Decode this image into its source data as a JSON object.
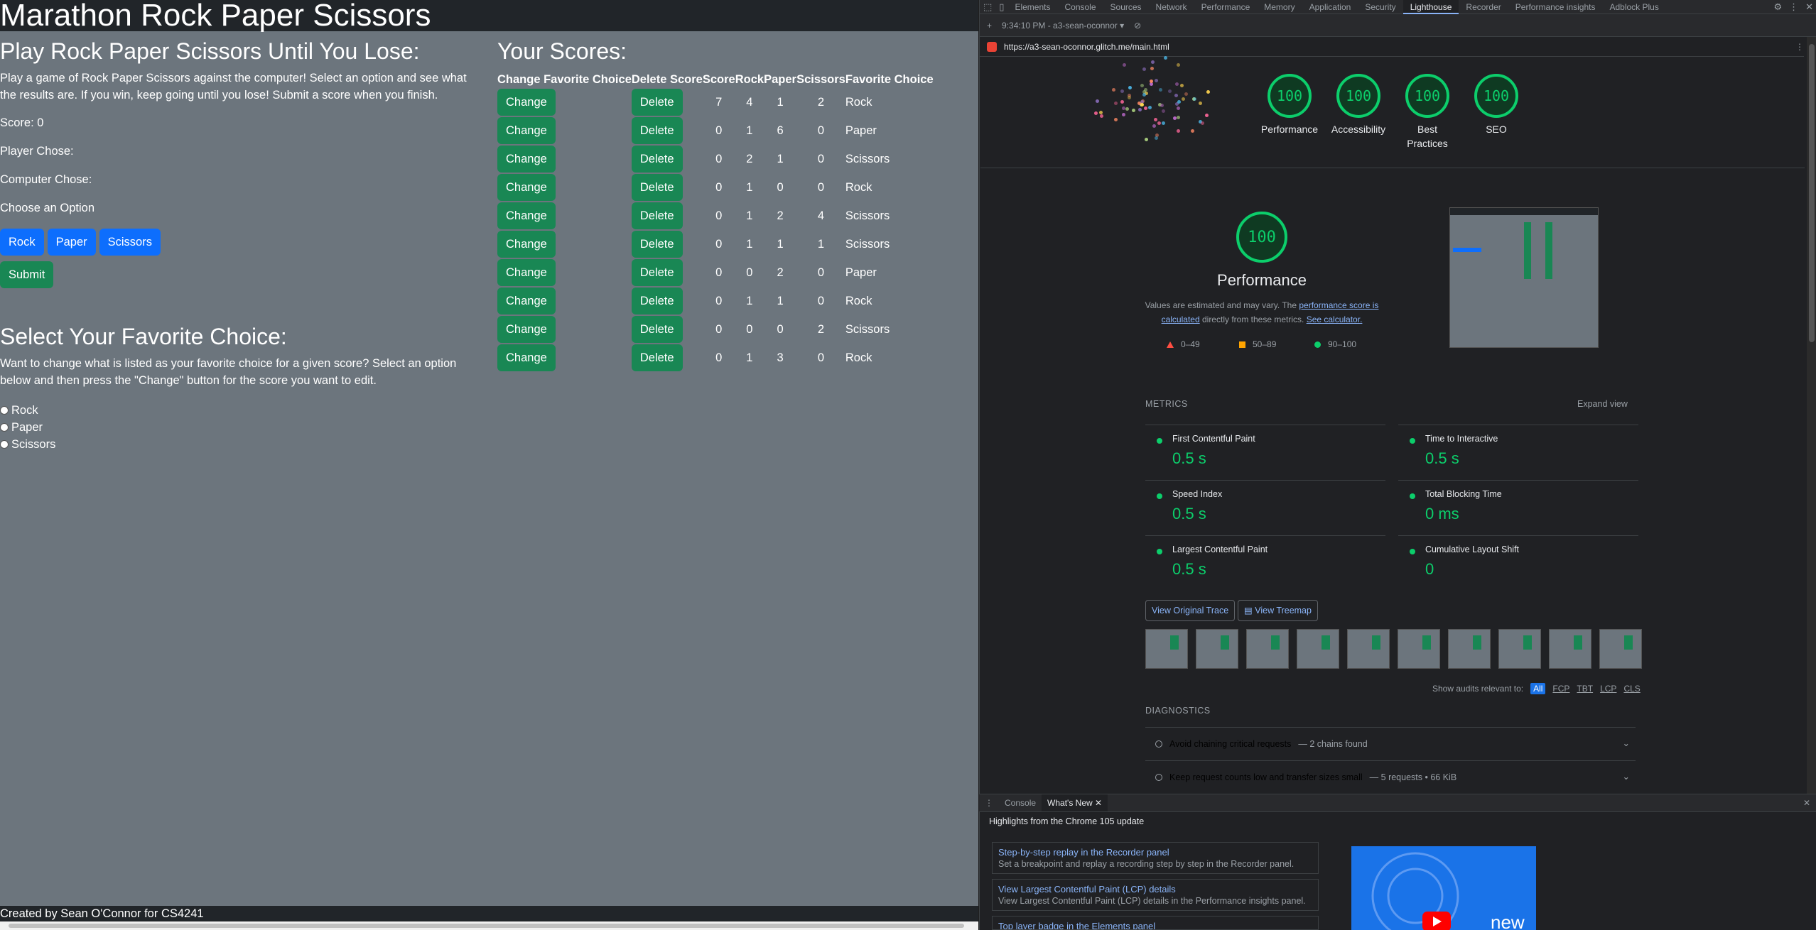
{
  "app": {
    "site_title": "Marathon Rock Paper Scissors",
    "play_heading": "Play Rock Paper Scissors Until You Lose:",
    "play_description": "Play a game of Rock Paper Scissors against the computer! Select an option and see what the results are. If you win, keep going until you lose! Submit a score when you finish.",
    "score_label": "Score: 0",
    "player_chose_label": "Player Chose:",
    "computer_chose_label": "Computer Chose:",
    "choose_option_label": "Choose an Option",
    "buttons": {
      "rock": "Rock",
      "paper": "Paper",
      "scissors": "Scissors",
      "submit": "Submit"
    },
    "favorite_heading": "Select Your Favorite Choice:",
    "favorite_description": "Want to change what is listed as your favorite choice for a given score? Select an option below and then press the \"Change\" button for the score you want to edit.",
    "radio_options": [
      "Rock",
      "Paper",
      "Scissors"
    ],
    "scores_heading": "Your Scores:",
    "table": {
      "headers": [
        "Change Favorite Choice",
        "Delete Score",
        "Score",
        "Rock",
        "Paper",
        "Scissors",
        "Favorite Choice"
      ],
      "change_label": "Change",
      "delete_label": "Delete",
      "rows": [
        {
          "score": "7",
          "rock": "4",
          "paper": "1",
          "scissors": "2",
          "favorite": "Rock"
        },
        {
          "score": "0",
          "rock": "1",
          "paper": "6",
          "scissors": "0",
          "favorite": "Paper"
        },
        {
          "score": "0",
          "rock": "2",
          "paper": "1",
          "scissors": "0",
          "favorite": "Scissors"
        },
        {
          "score": "0",
          "rock": "1",
          "paper": "0",
          "scissors": "0",
          "favorite": "Rock"
        },
        {
          "score": "0",
          "rock": "1",
          "paper": "2",
          "scissors": "4",
          "favorite": "Scissors"
        },
        {
          "score": "0",
          "rock": "1",
          "paper": "1",
          "scissors": "1",
          "favorite": "Scissors"
        },
        {
          "score": "0",
          "rock": "0",
          "paper": "2",
          "scissors": "0",
          "favorite": "Paper"
        },
        {
          "score": "0",
          "rock": "1",
          "paper": "1",
          "scissors": "0",
          "favorite": "Rock"
        },
        {
          "score": "0",
          "rock": "0",
          "paper": "0",
          "scissors": "2",
          "favorite": "Scissors"
        },
        {
          "score": "0",
          "rock": "1",
          "paper": "3",
          "scissors": "0",
          "favorite": "Rock"
        }
      ]
    },
    "footer": "Created by Sean O'Connor for CS4241",
    "colors": {
      "background": "#6c757d",
      "primary": "#0d6efd",
      "success": "#198754",
      "dark": "#212529"
    }
  },
  "devtools": {
    "tabs": [
      "Elements",
      "Console",
      "Sources",
      "Network",
      "Performance",
      "Memory",
      "Application",
      "Security",
      "Lighthouse",
      "Recorder",
      "Performance insights",
      "Adblock Plus"
    ],
    "active_tab": "Lighthouse",
    "report_selector": "9:34:10 PM - a3-sean-oconnor",
    "url": "https://a3-sean-oconnor.glitch.me/main.html",
    "gauges": [
      {
        "score": "100",
        "label": "Performance"
      },
      {
        "score": "100",
        "label": "Accessibility"
      },
      {
        "score": "100",
        "label": "Best Practices"
      },
      {
        "score": "100",
        "label": "SEO"
      }
    ],
    "main_score": "100",
    "perf_title": "Performance",
    "perf_note_1": "Values are estimated and may vary. The ",
    "perf_note_link1": "performance score is calculated",
    "perf_note_2": " directly from these metrics. ",
    "perf_note_link2": "See calculator.",
    "legend": [
      "0–49",
      "50–89",
      "90–100"
    ],
    "metrics_heading": "METRICS",
    "expand_view": "Expand view",
    "metrics": [
      {
        "name": "First Contentful Paint",
        "value": "0.5 s"
      },
      {
        "name": "Time to Interactive",
        "value": "0.5 s"
      },
      {
        "name": "Speed Index",
        "value": "0.5 s"
      },
      {
        "name": "Total Blocking Time",
        "value": "0 ms"
      },
      {
        "name": "Largest Contentful Paint",
        "value": "0.5 s"
      },
      {
        "name": "Cumulative Layout Shift",
        "value": "0"
      }
    ],
    "view_trace": "View Original Trace",
    "view_treemap": "View Treemap",
    "audits_relevant": "Show audits relevant to:",
    "audit_filters": [
      "All",
      "FCP",
      "TBT",
      "LCP",
      "CLS"
    ],
    "diagnostics_heading": "DIAGNOSTICS",
    "diagnostics": [
      {
        "title": "Avoid chaining critical requests",
        "detail": "— 2 chains found"
      },
      {
        "title": "Keep request counts low and transfer sizes small",
        "detail": "— 5 requests • 66 KiB"
      }
    ],
    "drawer_tabs": [
      "Console",
      "What's New"
    ],
    "whats_new_heading": "Highlights from the Chrome 105 update",
    "news": [
      {
        "title": "Step-by-step replay in the Recorder panel",
        "desc": "Set a breakpoint and replay a recording step by step in the Recorder panel."
      },
      {
        "title": "View Largest Contentful Paint (LCP) details",
        "desc": "View Largest Contentful Paint (LCP) details in the Performance insights panel."
      },
      {
        "title": "Top layer badge in the Elements panel",
        "desc": ""
      }
    ],
    "video_label": "new",
    "colors": {
      "pass": "#0cce6b",
      "average": "#ffa400",
      "fail": "#ff4e42",
      "link": "#8ab4f8"
    }
  }
}
